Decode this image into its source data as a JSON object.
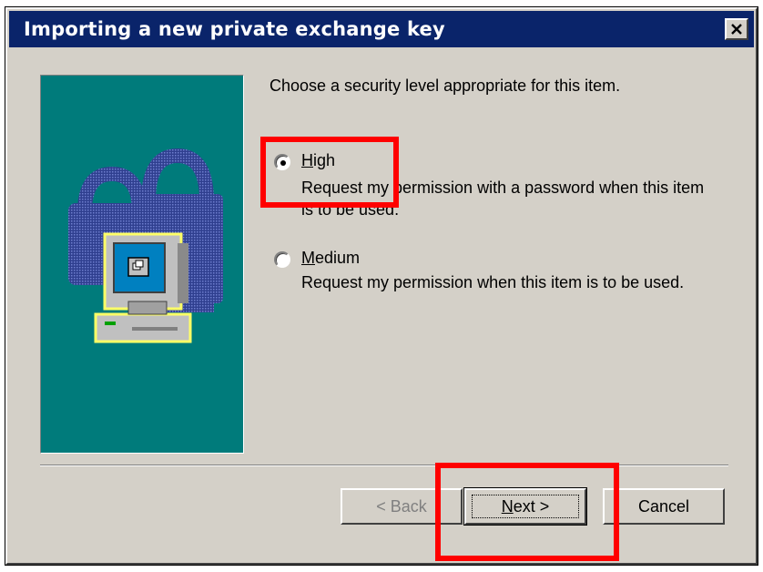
{
  "window": {
    "title": "Importing a new private exchange key",
    "close_glyph": "✕"
  },
  "content": {
    "prompt": "Choose a security level appropriate for this item.",
    "options": [
      {
        "label_mnemonic": "H",
        "label_rest": "igh",
        "description": "Request my permission with a password when this item is to be used.",
        "selected": true
      },
      {
        "label_mnemonic": "M",
        "label_rest": "edium",
        "description": "Request my permission when this item is to be used.",
        "selected": false
      }
    ]
  },
  "buttons": {
    "back": "< Back",
    "next_mnemonic": "N",
    "next_rest": "ext >",
    "cancel": "Cancel"
  },
  "icons": {
    "side_panel": "computer-with-padlock-icon"
  },
  "colors": {
    "title_bar": "#0a246a",
    "panel_teal": "#007b7b",
    "dialog_bg": "#d4d0c8",
    "annotation_red": "#ff0000"
  }
}
